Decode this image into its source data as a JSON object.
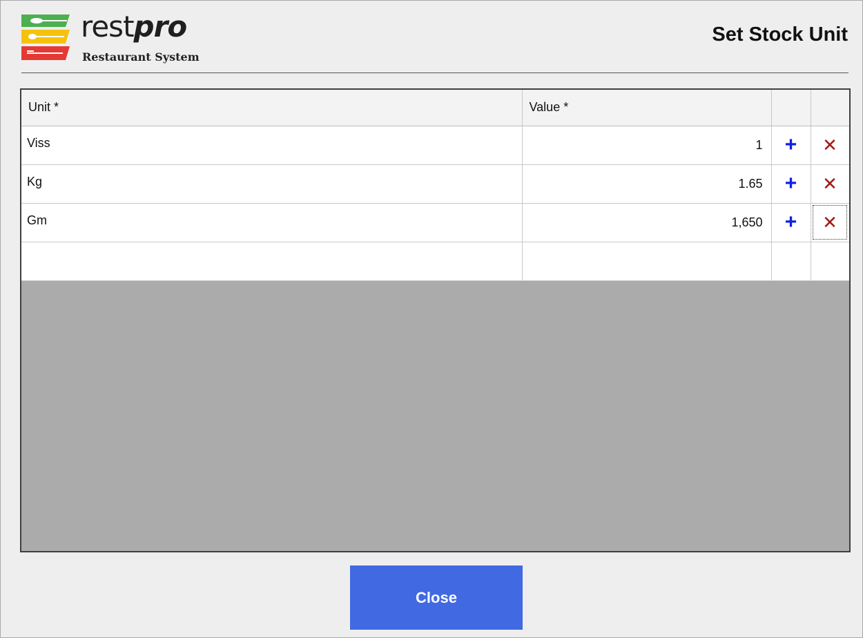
{
  "logo": {
    "word_regular": "rest",
    "word_italic": "pro",
    "subtitle": "Restaurant System"
  },
  "header": {
    "title": "Set Stock Unit"
  },
  "grid": {
    "columns": [
      "Unit *",
      "Value *",
      "",
      ""
    ],
    "rows": [
      {
        "unit": "Viss",
        "value": "1",
        "add_icon": "plus-icon",
        "delete_icon": "cross-icon"
      },
      {
        "unit": "Kg",
        "value": "1.65",
        "add_icon": "plus-icon",
        "delete_icon": "cross-icon"
      },
      {
        "unit": "Gm",
        "value": "1,650",
        "add_icon": "plus-icon",
        "delete_icon": "cross-icon"
      }
    ],
    "new_row": {
      "unit": "",
      "value": ""
    }
  },
  "footer": {
    "close_label": "Close"
  },
  "colors": {
    "accent_button": "#4169e1",
    "add_icon": "#1020e0",
    "delete_icon": "#a01a1a",
    "grid_background": "#ababab"
  }
}
